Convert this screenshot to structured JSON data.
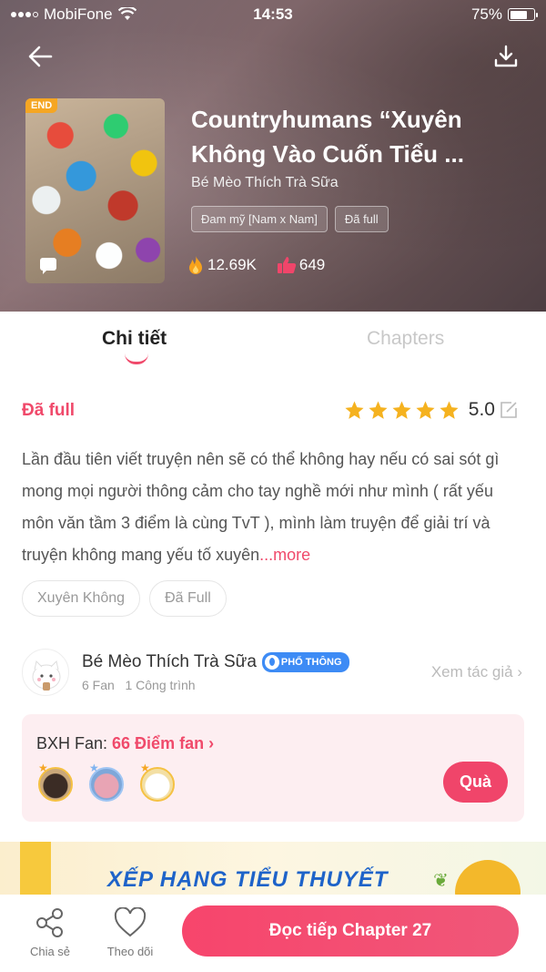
{
  "status_bar": {
    "carrier": "MobiFone",
    "time": "14:53",
    "battery": "75%",
    "battery_level": 0.75
  },
  "book": {
    "cover_badge": "END",
    "title": "Countryhumans “Xuyên Không Vào Cuốn Tiểu ...",
    "author": "Bé Mèo Thích Trà Sữa",
    "tags": [
      "Đam mỹ [Nam x Nam]",
      "Đã full"
    ],
    "views": "12.69K",
    "likes": "649"
  },
  "tabs": [
    {
      "label": "Chi tiết",
      "active": true
    },
    {
      "label": "Chapters",
      "active": false
    }
  ],
  "detail": {
    "status": "Đã full",
    "rating": "5.0",
    "stars": 5,
    "description": "Lần đầu tiên viết truyện nên sẽ có thể không hay nếu có sai sót gì mong mọi người thông cảm cho tay nghề mới như mình ( rất yếu môn văn tầm 3 điểm là cùng TvT ), mình làm truyện để giải trí và truyện không mang yếu tố xuyên",
    "more": "...more",
    "genres": [
      "Xuyên Không",
      "Đã Full"
    ]
  },
  "author_card": {
    "name": "Bé Mèo Thích Trà Sữa",
    "rank": "PHỔ THÔNG",
    "fans": "6 Fan",
    "works": "1 Công trình",
    "view_author": "Xem tác giả ›"
  },
  "fan_box": {
    "label": "BXH Fan: ",
    "points": "66 Điểm fan ›",
    "gift_button": "Quà"
  },
  "banner": {
    "text": "XẾP HẠNG TIỂU THUYẾT"
  },
  "bottom_bar": {
    "share": "Chia sẻ",
    "follow": "Theo dõi",
    "read": "Đọc tiếp Chapter 27"
  },
  "colors": {
    "accent": "#f04a6b",
    "header_bg": "#7a6468",
    "rank_badge": "#3d8bf5",
    "star": "#f5b21f"
  }
}
